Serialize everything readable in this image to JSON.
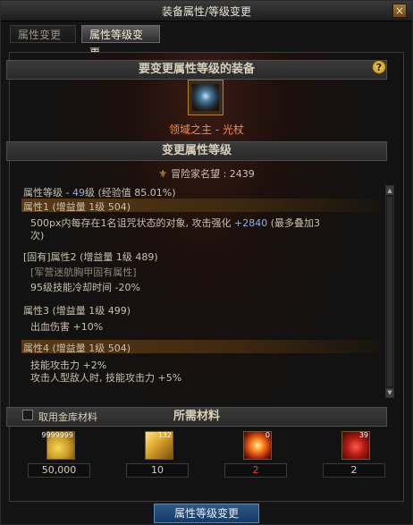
{
  "window": {
    "title": "装备属性/等级变更"
  },
  "tabs": [
    {
      "label": "属性变更"
    },
    {
      "label": "属性等级变更"
    }
  ],
  "equipment": {
    "header": "要变更属性等级的装备",
    "item_name": "领域之主 - 光杖"
  },
  "change": {
    "header": "变更属性等级",
    "renown": "冒险家名望 : 2439"
  },
  "attributes": {
    "level_prefix": "属性等级 - ",
    "level_value": "49",
    "level_suffix": "级 (经验值 85.01%)",
    "a1_title": "属性1 (增益量 1级 504)",
    "a1_desc_start": "500px内每存在1名诅咒状态的对象, 攻击强化 ",
    "a1_desc_value": "+2840",
    "a1_desc_end": " (最多叠加3",
    "a1_desc_line2": "次)",
    "a2_title": "[固有]属性2 (增益量 1级 489)",
    "a2_sub": "[军营迷航胸甲固有属性]",
    "a2_desc": "95级技能冷却时间 -20%",
    "a3_title": "属性3 (增益量 1级 499)",
    "a3_desc": "出血伤害 +10%",
    "a4_title": "属性4 (增益量 1级 504)",
    "a4_desc1": "技能攻击力 +2%",
    "a4_desc2": "攻击人型敌人时, 技能攻击力 +5%"
  },
  "materials": {
    "checkbox_label": "取用金库材料",
    "header": "所需材料",
    "items": [
      {
        "badge": "9999999",
        "amount": "50,000",
        "icon": "gold-coins-icon"
      },
      {
        "badge": "132",
        "amount": "10",
        "icon": "gold-crystal-icon"
      },
      {
        "badge": "0",
        "amount": "2",
        "icon": "fire-orb-icon"
      },
      {
        "badge": "39",
        "amount": "2",
        "icon": "red-essence-icon"
      }
    ]
  },
  "footer": {
    "button_label": "属性等级变更"
  }
}
